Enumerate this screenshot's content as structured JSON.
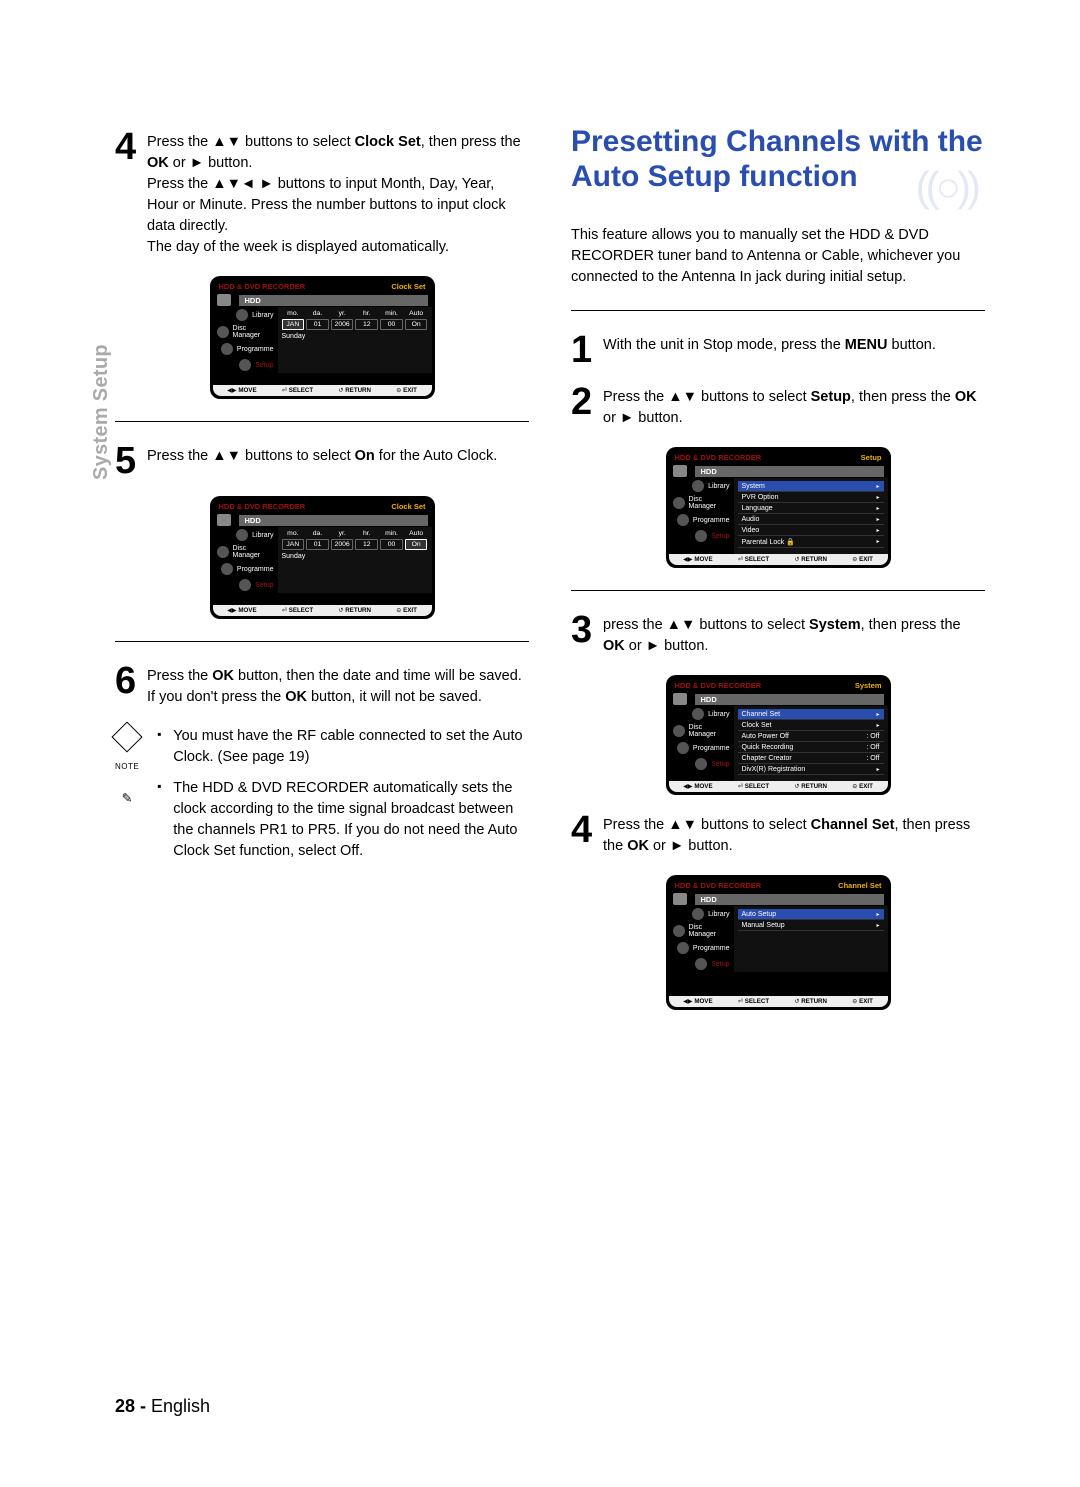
{
  "sideTab": "System Setup",
  "left": {
    "step4": {
      "num": "4",
      "t1": "Press the ",
      "t2": " buttons to select ",
      "bold1": "Clock Set",
      "t3": ", then press the ",
      "bold2": "OK",
      "t4": " or ",
      "t5": " button.",
      "t6": "Press the ",
      "t7": " buttons to input Month, Day, Year, Hour or Minute. Press the number buttons to input clock data directly.",
      "t8": "The day of the week is displayed automatically."
    },
    "step5": {
      "num": "5",
      "t1": "Press the ",
      "t2": " buttons to select ",
      "bold1": "On",
      "t3": " for the Auto Clock."
    },
    "step6": {
      "num": "6",
      "t1": "Press the ",
      "bold1": "OK",
      "t2": " button, then the date and time will be saved. If you don't press the ",
      "bold2": "OK",
      "t3": " button, it will not be saved."
    },
    "notes": {
      "label": "NOTE",
      "n1": "You must have the RF cable connected to set the Auto Clock. (See page 19)",
      "n2": "The HDD & DVD RECORDER automatically sets the clock according to the time signal broadcast between the channels PR1 to PR5. If you do not need the Auto Clock Set function, select Off."
    }
  },
  "right": {
    "heading": "Presetting Channels with the Auto Setup function",
    "intro": "This feature allows you to manually set the HDD & DVD RECORDER tuner band to Antenna or Cable, whichever you connected to the Antenna In jack during initial setup.",
    "step1": {
      "num": "1",
      "t1": "With the unit in Stop mode, press the ",
      "bold": "MENU",
      "t2": " button."
    },
    "step2": {
      "num": "2",
      "t1": "Press the ",
      "t2": " buttons to select ",
      "bold": "Setup",
      "t3": ", then press the ",
      "bold2": "OK",
      "t4": " or ",
      "t5": " button."
    },
    "step3": {
      "num": "3",
      "t1": "press the ",
      "t2": " buttons to select ",
      "bold": "System",
      "t3": ", then press the ",
      "bold2": "OK",
      "t4": " or ",
      "t5": " button."
    },
    "step4": {
      "num": "4",
      "t1": "Press the ",
      "t2": " buttons to select ",
      "bold": "Channel Set",
      "t3": ", then press the ",
      "bold2": "OK",
      "t4": " or ",
      "t5": " button."
    }
  },
  "screens": {
    "brand": "HDD & DVD RECORDER",
    "hdd": "HDD",
    "nav": [
      "Library",
      "Disc Manager",
      "Programme",
      "Setup"
    ],
    "botLabels": {
      "move": "MOVE",
      "select": "SELECT",
      "return": "RETURN",
      "exit": "EXIT"
    },
    "clock": {
      "title": "Clock Set",
      "cols": [
        "mo.",
        "da.",
        "yr.",
        "hr.",
        "min.",
        "Auto"
      ],
      "vals": [
        "JAN",
        "01",
        "2006",
        "12",
        "00",
        "On"
      ],
      "day": "Sunday"
    },
    "setup": {
      "title": "Setup",
      "items": [
        "System",
        "PVR Option",
        "Language",
        "Audio",
        "Video",
        "Parental Lock 🔒"
      ]
    },
    "system": {
      "title": "System",
      "items": [
        {
          "l": "Channel Set",
          "r": ""
        },
        {
          "l": "Clock Set",
          "r": ""
        },
        {
          "l": "Auto Power Off",
          "r": ": Off"
        },
        {
          "l": "Quick Recording",
          "r": ": Off"
        },
        {
          "l": "Chapter Creator",
          "r": ": Off"
        },
        {
          "l": "DivX(R) Registration",
          "r": ""
        }
      ]
    },
    "channel": {
      "title": "Channel Set",
      "items": [
        "Auto Setup",
        "Manual Setup"
      ]
    }
  },
  "footer": {
    "page": "28 - ",
    "lang": "English"
  }
}
